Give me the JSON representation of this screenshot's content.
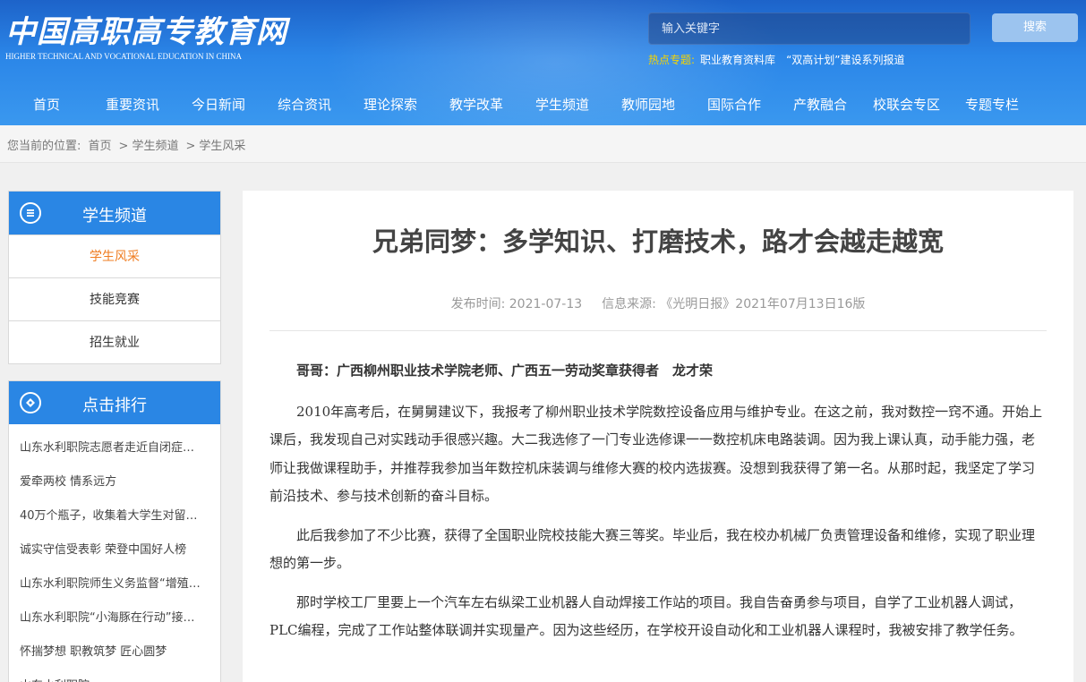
{
  "header": {
    "logo_cn": "中国高职高专教育网",
    "logo_en": "HIGHER TECHNICAL AND VOCATIONAL EDUCATION IN CHINA",
    "search_placeholder": "输入关键字",
    "search_button": "搜索",
    "hot_label": "热点专题:",
    "hot_links": [
      "职业教育资料库",
      "“双高计划”建设系列报道"
    ]
  },
  "nav": [
    "首页",
    "重要资讯",
    "今日新闻",
    "综合资讯",
    "理论探索",
    "教学改革",
    "学生频道",
    "教师园地",
    "国际合作",
    "产教融合",
    "校联会专区",
    "专题专栏"
  ],
  "breadcrumb": {
    "prefix": "您当前的位置:",
    "items": [
      "首页",
      "学生频道",
      "学生风采"
    ],
    "separator": ">"
  },
  "sidebar": {
    "channel_title": "学生频道",
    "channel_items": [
      "学生风采",
      "技能竞赛",
      "招生就业"
    ],
    "rank_title": "点击排行",
    "rank_items": [
      "山东水利职院志愿者走近自闭症…",
      "爱牵两校 情系远方",
      "40万个瓶子，收集着大学生对留…",
      "诚实守信受表彰 荣登中国好人榜",
      "山东水利职院师生义务监督“增殖…",
      "山东水利职院“小海豚在行动”接…",
      "怀揣梦想 职教筑梦 匠心圆梦",
      "山东水利职院"
    ]
  },
  "article": {
    "title": "兄弟同梦：多学知识、打磨技术，路才会越走越宽",
    "date_label": "发布时间: 2021-07-13",
    "source_label": "信息来源: 《光明日报》2021年07月13日16版",
    "lead": "哥哥：广西柳州职业技术学院老师、广西五一劳动奖章获得者　龙才荣",
    "paragraphs": [
      "2010年高考后，在舅舅建议下，我报考了柳州职业技术学院数控设备应用与维护专业。在这之前，我对数控一窍不通。开始上课后，我发现自己对实践动手很感兴趣。大二我选修了一门专业选修课一一数控机床电路装调。因为我上课认真，动手能力强，老师让我做课程助手，并推荐我参加当年数控机床装调与维修大赛的校内选拔赛。没想到我获得了第一名。从那时起，我坚定了学习前沿技术、参与技术创新的奋斗目标。",
      "此后我参加了不少比赛，获得了全国职业院校技能大赛三等奖。毕业后，我在校办机械厂负责管理设备和维修，实现了职业理想的第一步。",
      "那时学校工厂里要上一个汽车左右纵梁工业机器人自动焊接工作站的项目。我自告奋勇参与项目，自学了工业机器人调试，PLC编程，完成了工作站整体联调并实现量产。因为这些经历，在学校开设自动化和工业机器人课程时，我被安排了教学任务。"
    ]
  }
}
